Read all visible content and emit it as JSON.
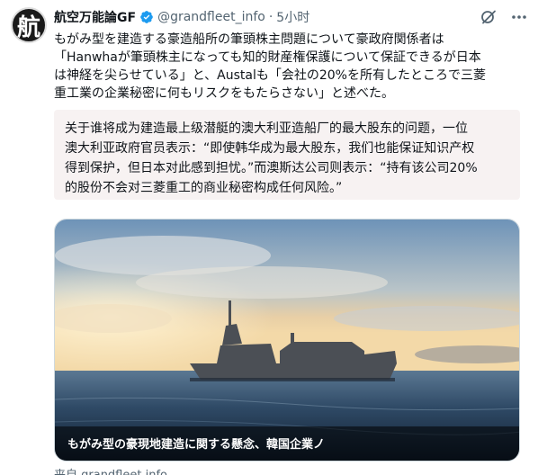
{
  "author": {
    "avatar_glyph": "航",
    "name": "航空万能論GF",
    "handle": "@grandfleet_info",
    "separator": "·",
    "time": "5小时"
  },
  "icons": {
    "verified": "verified-badge-icon",
    "grok": "grok-icon",
    "more": "more-icon",
    "verified_color": "#1d9bf0"
  },
  "tweet": {
    "lines": [
      "もがみ型を建造する豪造船所の筆頭株主問題について豪政府関係者は",
      "「Hanwhaが筆頭株主になっても知的財産権保護について保証できるが日本",
      "は神経を尖らせている」と、Austalも「会社の20%を所有したところで三菱",
      "重工業の企業秘密に何もリスクをもたらさない」と述べた。"
    ]
  },
  "translation": {
    "lines": [
      "关于谁将成为建造最上级潜艇的澳大利亚造船厂的最大股东的问题，一位",
      "澳大利亚政府官员表示：“即使韩华成为最大股东，我们也能保证知识产权",
      "得到保护，但日本对此感到担忧。”而澳斯达公司则表示：“持有该公司20%",
      "的股份不会对三菱重工的商业秘密构成任何风险。”"
    ]
  },
  "media": {
    "caption": "もがみ型の豪現地建造に関する懸念、韓国企業ノ"
  },
  "source": "来自 grandfleet.info"
}
